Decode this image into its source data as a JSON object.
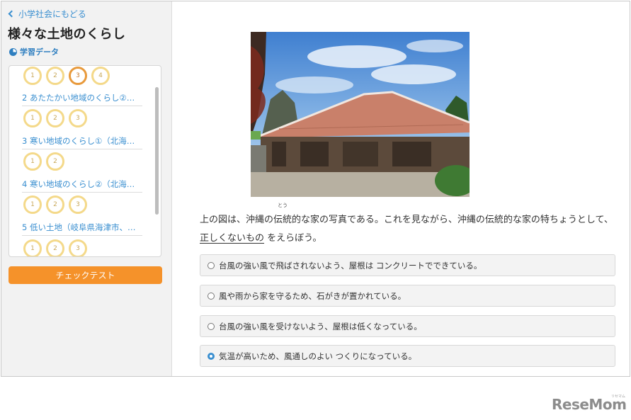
{
  "sidebar": {
    "back_label": "小学社会にもどる",
    "title": "様々な土地のくらし",
    "learning_data_label": "学習データ",
    "units": [
      {
        "label": "2 あたたかい地域のくらし②…",
        "levels": [
          "1",
          "2",
          "3"
        ]
      },
      {
        "label": "3 寒い地域のくらし①（北海…",
        "levels": [
          "1",
          "2"
        ]
      },
      {
        "label": "4 寒い地域のくらし②（北海…",
        "levels": [
          "1",
          "2",
          "3"
        ]
      },
      {
        "label": "5 低い土地（岐阜県海津市、…",
        "levels": [
          "1",
          "2",
          "3"
        ]
      }
    ],
    "top_levels": [
      "1",
      "2",
      "3",
      "4"
    ],
    "active_level": "3",
    "check_test_label": "チェックテスト"
  },
  "question": {
    "text_1": "上の図は、沖縄の",
    "ruby_base": "伝統",
    "ruby_text": "とう",
    "text_2": "的な家の写真である。これを見ながら、沖縄の伝統的な家の特ちょうとして、",
    "underlined": "正しくないもの",
    "text_3": "をえらぼう。"
  },
  "options": [
    {
      "label": "台風の強い風で飛ばされないよう、屋根は コンクリートでできている。",
      "selected": false
    },
    {
      "label": "風や雨から家を守るため、石がきが置かれている。",
      "selected": false
    },
    {
      "label": "台風の強い風を受けないよう、屋根は低くなっている。",
      "selected": false
    },
    {
      "label": "気温が高いため、風通しのよい つくりになっている。",
      "selected": true
    }
  ],
  "watermark": {
    "text": "ReseMom",
    "ruby": "リセマム"
  },
  "colors": {
    "accent": "#3a8fd0",
    "button": "#f5922a",
    "level_ring": "#f4d98a",
    "level_active": "#e89a3c"
  }
}
